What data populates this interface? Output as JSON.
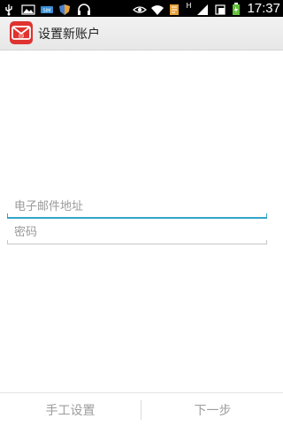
{
  "status_bar": {
    "time": "17:37",
    "left_icons": [
      "usb-icon",
      "image-icon",
      "sim-icon",
      "shield-icon",
      "headphones-icon"
    ],
    "right_icons": [
      "eye-icon",
      "wifi-icon",
      "notes-icon",
      "hspa-icon",
      "signal-icon",
      "screenshot-icon",
      "battery-icon"
    ],
    "network_label": "H"
  },
  "action_bar": {
    "title": "设置新账户",
    "logo_icon": "mail-app-icon"
  },
  "form": {
    "email_placeholder": "电子邮件地址",
    "email_value": "",
    "password_placeholder": "密码",
    "password_value": ""
  },
  "bottom": {
    "manual_setup_label": "手工设置",
    "next_label": "下一步"
  },
  "colors": {
    "accent": "#33a4c9",
    "logo_red": "#e0322f",
    "disabled_text": "#9d9d9d"
  }
}
